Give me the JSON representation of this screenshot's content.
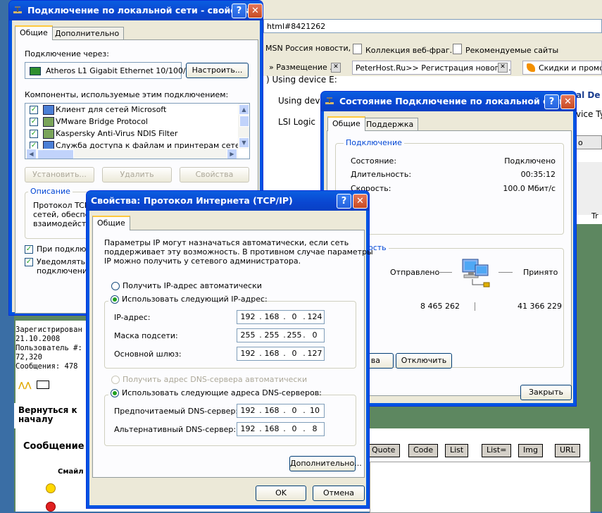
{
  "browser": {
    "address": "html#8421262",
    "favorites": [
      "MSN Россия новости, ...",
      "Коллекция веб-фраг...",
      "Рекомендуемые сайты"
    ],
    "tabs": [
      "» Размещение ...",
      "PeterHost.Ru>> Регистрация нового ...",
      "Скидки и промо-..."
    ],
    "page_lines": [
      ") Using device E:",
      "Using devi",
      "LSI Logic"
    ],
    "right_fragments": [
      "al De",
      "vice Ty",
      "o",
      "Tr"
    ]
  },
  "forum": {
    "user_info": [
      "Зарегистрирован",
      "21.10.2008",
      "Пользователь #:",
      "72,320",
      "Сообщения: 478"
    ],
    "back_to_top": "Вернуться к началу",
    "message_label": "Сообщение",
    "smiles_label": "Смайл",
    "bbcode": [
      "Quote",
      "Code",
      "List",
      "List=",
      "Img",
      "URL"
    ]
  },
  "lan_props": {
    "title": "Подключение по локальной сети - свойства",
    "tabs": [
      "Общие",
      "Дополнительно"
    ],
    "connect_using_label": "Подключение через:",
    "adapter_name": "Atheros L1 Gigabit Ethernet 10/100/",
    "configure_btn": "Настроить...",
    "components_label": "Компоненты, используемые этим подключением:",
    "components": [
      {
        "label": "Клиент для сетей Microsoft",
        "checked": true
      },
      {
        "label": "VMware Bridge Protocol",
        "checked": true
      },
      {
        "label": "Kaspersky Anti-Virus NDIS Filter",
        "checked": true
      },
      {
        "label": "Служба доступа к файлам и принтерам сетей Micro",
        "checked": true
      }
    ],
    "install_btn": "Установить...",
    "remove_btn": "Удалить",
    "properties_btn": "Свойства",
    "description_label": "Описание",
    "description_lines": [
      "Протокол TCP",
      "сетей, обеспеч",
      "взаимодейств"
    ],
    "show_icon_label": "При подключ",
    "notify_lines": [
      "Уведомлять п",
      "подключени"
    ]
  },
  "status": {
    "title": "Состояние Подключение по локальной сети",
    "tabs": [
      "Общие",
      "Поддержка"
    ],
    "connection_group": "Подключение",
    "rows": [
      {
        "label": "Состояние:",
        "value": "Подключено"
      },
      {
        "label": "Длительность:",
        "value": "00:35:12"
      },
      {
        "label": "Скорость:",
        "value": "100.0 Мбит/с"
      }
    ],
    "activity_group": "ость",
    "sent_label": "Отправлено",
    "received_label": "Принято",
    "sent_value": "8 465 262",
    "received_value": "41 366 229",
    "props_btn": "ва",
    "disable_btn": "Отключить",
    "close_btn": "Закрыть"
  },
  "tcpip": {
    "title": "Свойства: Протокол Интернета (TCP/IP)",
    "tab": "Общие",
    "intro": [
      "Параметры IP могут назначаться автоматически, если сеть",
      "поддерживает эту возможность. В противном случае параметры",
      "IP можно получить у сетевого администратора."
    ],
    "auto_ip": "Получить IP-адрес автоматически",
    "manual_ip": "Использовать следующий IP-адрес:",
    "ip_label": "IP-адрес:",
    "ip": [
      "192",
      "168",
      "0",
      "124"
    ],
    "mask_label": "Маска подсети:",
    "mask": [
      "255",
      "255",
      "255",
      "0"
    ],
    "gateway_label": "Основной шлюз:",
    "gateway": [
      "192",
      "168",
      "0",
      "127"
    ],
    "auto_dns": "Получить адрес DNS-сервера автоматически",
    "manual_dns": "Использовать следующие адреса DNS-серверов:",
    "pref_dns_label": "Предпочитаемый DNS-сервер:",
    "pref_dns": [
      "192",
      "168",
      "0",
      "10"
    ],
    "alt_dns_label": "Альтернативный DNS-сервер:",
    "alt_dns": [
      "192",
      "168",
      "0",
      "8"
    ],
    "advanced_btn": "Дополнительно...",
    "ok_btn": "OK",
    "cancel_btn": "Отмена"
  }
}
